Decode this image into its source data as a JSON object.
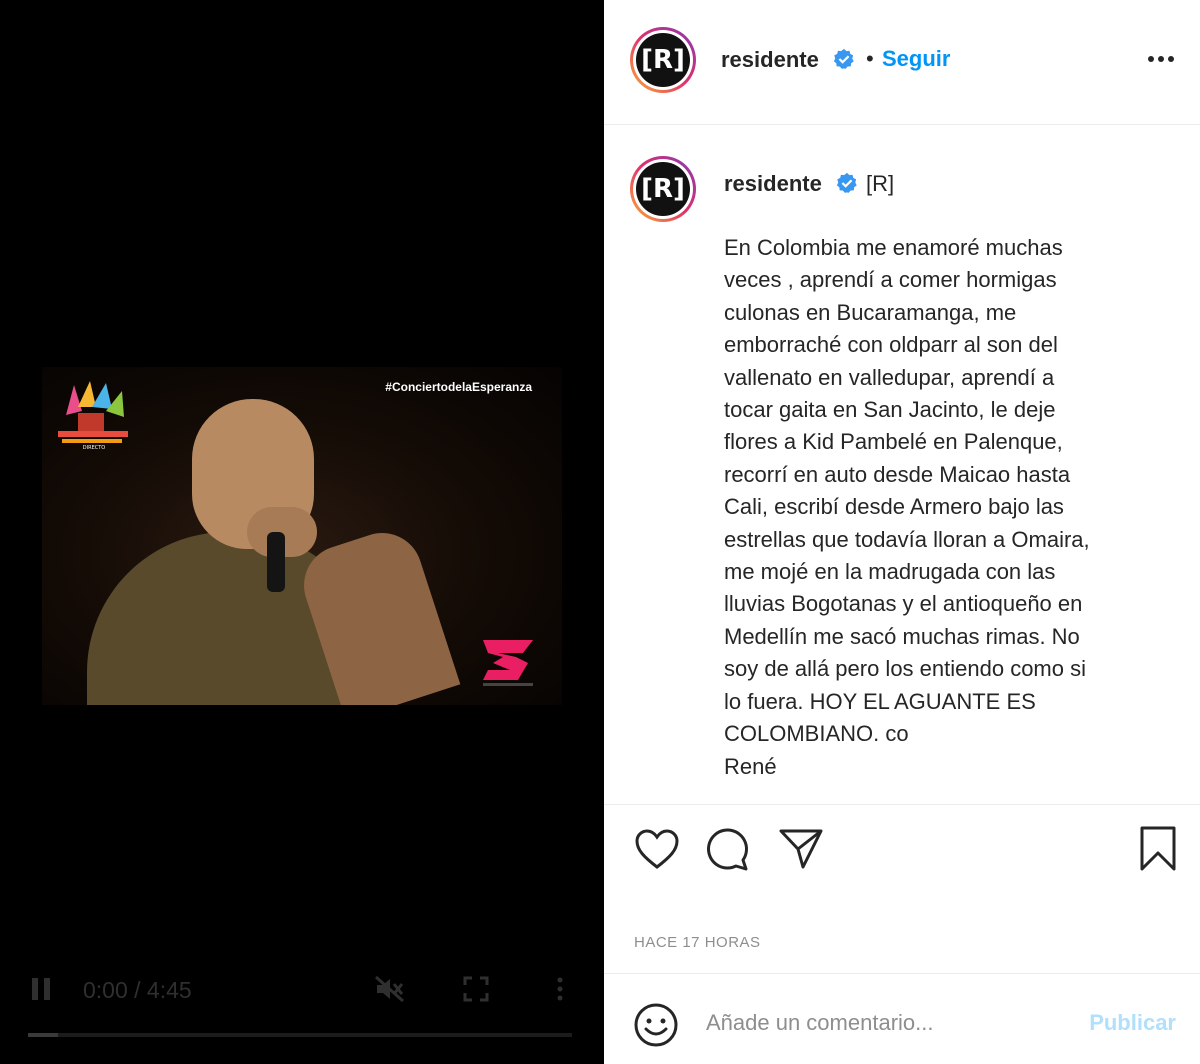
{
  "video": {
    "hashtag": "#ConciertodelaEsperanza",
    "logo_left": "CONCIERTO DE LA ESPERANZA DIRECTO",
    "time": "0:00 / 4:45",
    "progress": 0.0
  },
  "header": {
    "username": "residente",
    "separator": "•",
    "follow_label": "Seguir",
    "avatar_text": "[R]"
  },
  "caption": {
    "username": "residente",
    "tag": "[R]",
    "avatar_text": "[R]",
    "lines": [
      "En Colombia me enamoré muchas",
      "veces , aprendí a comer hormigas",
      "culonas en Bucaramanga, me",
      "emborraché con oldparr al son del",
      "vallenato en valledupar, aprendí a",
      "tocar gaita en San Jacinto, le deje",
      "flores a Kid Pambelé en Palenque,",
      "recorrí en auto desde Maicao hasta",
      "Cali, escribí desde Armero bajo las",
      "estrellas que todavía lloran a Omaira,",
      "me mojé en la madrugada con las",
      "lluvias Bogotanas y el antioqueño en",
      "Medellín me sacó muchas rimas. No",
      "soy de allá pero los entiendo como si",
      "lo fuera. HOY EL AGUANTE ES",
      "COLOMBIANO. co",
      "René"
    ]
  },
  "actions": {
    "like_icon": "heart-icon",
    "comment_icon": "comment-icon",
    "share_icon": "send-icon",
    "save_icon": "bookmark-icon"
  },
  "timestamp": "HACE 17 HORAS",
  "comment_box": {
    "placeholder": "Añade un comentario...",
    "publish_label": "Publicar"
  },
  "colors": {
    "link": "#0095f6",
    "publish_disabled": "#b2dffc",
    "verified": "#3897f0"
  }
}
